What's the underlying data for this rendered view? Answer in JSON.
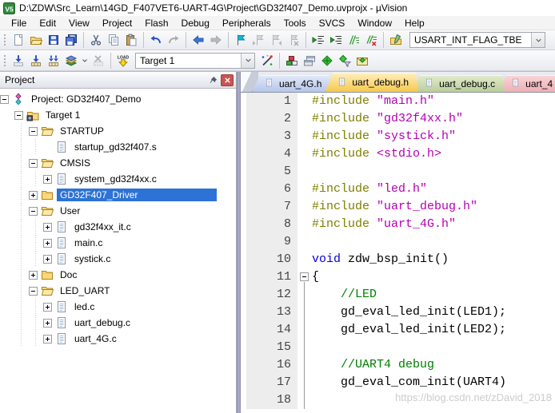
{
  "window": {
    "title": "D:\\ZDW\\Src_Learn\\14GD_F407VET6-UART-4G\\Project\\GD32f407_Demo.uvprojx - µVision"
  },
  "menu": {
    "items": [
      "File",
      "Edit",
      "View",
      "Project",
      "Flash",
      "Debug",
      "Peripherals",
      "Tools",
      "SVCS",
      "Window",
      "Help"
    ]
  },
  "toolbar1": {
    "groups": [
      [
        {
          "n": "new-file"
        },
        {
          "n": "open-file"
        },
        {
          "n": "save"
        },
        {
          "n": "save-all"
        }
      ],
      [
        {
          "n": "cut"
        },
        {
          "n": "copy"
        },
        {
          "n": "paste"
        }
      ],
      [
        {
          "n": "undo"
        },
        {
          "n": "redo",
          "d": true
        }
      ],
      [
        {
          "n": "navigate-back"
        },
        {
          "n": "navigate-forward",
          "d": true
        }
      ],
      [
        {
          "n": "toggle-bookmark"
        },
        {
          "n": "prev-bookmark",
          "d": true
        },
        {
          "n": "next-bookmark",
          "d": true
        },
        {
          "n": "clear-bookmarks",
          "d": true
        }
      ],
      [
        {
          "n": "outdent"
        },
        {
          "n": "indent"
        },
        {
          "n": "comment-selection"
        },
        {
          "n": "uncomment-selection"
        }
      ],
      [
        {
          "n": "find-in-files"
        }
      ]
    ],
    "search_value": "USART_INT_FLAG_TBE"
  },
  "toolbar2": {
    "left_groups": [
      [
        {
          "n": "translate-file"
        },
        {
          "n": "build"
        },
        {
          "n": "rebuild-all"
        },
        {
          "n": "batch-build"
        },
        {
          "n": "batch-build-caret",
          "caret": true
        },
        {
          "n": "stop-build",
          "d": true
        }
      ],
      [
        {
          "n": "download-load"
        }
      ]
    ],
    "target_value": "Target 1",
    "right_groups": [
      [
        {
          "n": "options-for-target"
        }
      ],
      [
        {
          "n": "manage-components"
        },
        {
          "n": "manage-books"
        },
        {
          "n": "manage-run-time-environment"
        },
        {
          "n": "select-software-packs"
        },
        {
          "n": "pack-installer"
        }
      ]
    ]
  },
  "project_panel": {
    "title": "Project",
    "tree": [
      {
        "label": "Project: GD32f407_Demo",
        "level": 0,
        "exp": "minus",
        "icon": "project"
      },
      {
        "label": "Target 1",
        "level": 1,
        "exp": "minus",
        "icon": "target"
      },
      {
        "label": "STARTUP",
        "level": 2,
        "exp": "minus",
        "icon": "folder-open"
      },
      {
        "label": "startup_gd32f407.s",
        "level": 3,
        "exp": "none",
        "icon": "file"
      },
      {
        "label": "CMSIS",
        "level": 2,
        "exp": "minus",
        "icon": "folder-open"
      },
      {
        "label": "system_gd32f4xx.c",
        "level": 3,
        "exp": "plus",
        "icon": "file"
      },
      {
        "label": "GD32F407_Driver",
        "level": 2,
        "exp": "plus",
        "icon": "folder-closed",
        "selected": true
      },
      {
        "label": "User",
        "level": 2,
        "exp": "minus",
        "icon": "folder-open"
      },
      {
        "label": "gd32f4xx_it.c",
        "level": 3,
        "exp": "plus",
        "icon": "file"
      },
      {
        "label": "main.c",
        "level": 3,
        "exp": "plus",
        "icon": "file"
      },
      {
        "label": "systick.c",
        "level": 3,
        "exp": "plus",
        "icon": "file"
      },
      {
        "label": "Doc",
        "level": 2,
        "exp": "plus",
        "icon": "folder-closed"
      },
      {
        "label": "LED_UART",
        "level": 2,
        "exp": "minus",
        "icon": "folder-open"
      },
      {
        "label": "led.c",
        "level": 3,
        "exp": "plus",
        "icon": "file"
      },
      {
        "label": "uart_debug.c",
        "level": 3,
        "exp": "plus",
        "icon": "file"
      },
      {
        "label": "uart_4G.c",
        "level": 3,
        "exp": "plus",
        "icon": "file"
      }
    ]
  },
  "editor": {
    "tabs": [
      {
        "label": "uart_4G.h",
        "color": "blue",
        "active": false
      },
      {
        "label": "uart_debug.h",
        "color": "yellow",
        "active": true
      },
      {
        "label": "uart_debug.c",
        "color": "green",
        "active": false
      },
      {
        "label": "uart_4",
        "color": "pink",
        "active": false,
        "cut": true
      }
    ],
    "code_lines": [
      {
        "num": 1,
        "fold": "",
        "segs": [
          [
            "#include ",
            "dir"
          ],
          [
            "\"main.h\"",
            "str"
          ]
        ]
      },
      {
        "num": 2,
        "fold": "",
        "segs": [
          [
            "#include ",
            "dir"
          ],
          [
            "\"gd32f4xx.h\"",
            "str"
          ]
        ]
      },
      {
        "num": 3,
        "fold": "",
        "segs": [
          [
            "#include ",
            "dir"
          ],
          [
            "\"systick.h\"",
            "str"
          ]
        ]
      },
      {
        "num": 4,
        "fold": "",
        "segs": [
          [
            "#include ",
            "dir"
          ],
          [
            "<stdio.h>",
            "str"
          ]
        ]
      },
      {
        "num": 5,
        "fold": "",
        "segs": []
      },
      {
        "num": 6,
        "fold": "",
        "segs": [
          [
            "#include ",
            "dir"
          ],
          [
            "\"led.h\"",
            "str"
          ]
        ]
      },
      {
        "num": 7,
        "fold": "",
        "segs": [
          [
            "#include ",
            "dir"
          ],
          [
            "\"uart_debug.h\"",
            "str"
          ]
        ]
      },
      {
        "num": 8,
        "fold": "",
        "segs": [
          [
            "#include ",
            "dir"
          ],
          [
            "\"uart_4G.h\"",
            "str"
          ]
        ]
      },
      {
        "num": 9,
        "fold": "",
        "segs": []
      },
      {
        "num": 10,
        "fold": "",
        "segs": [
          [
            "void",
            "kw"
          ],
          [
            " zdw_bsp_init()",
            "pl"
          ]
        ]
      },
      {
        "num": 11,
        "fold": "box",
        "segs": [
          [
            "{",
            "pl"
          ]
        ]
      },
      {
        "num": 12,
        "fold": "line",
        "segs": [
          [
            "    ",
            "pl"
          ],
          [
            "//LED",
            "com"
          ]
        ]
      },
      {
        "num": 13,
        "fold": "line",
        "segs": [
          [
            "    gd_eval_led_init(LED1);",
            "pl"
          ]
        ]
      },
      {
        "num": 14,
        "fold": "line",
        "segs": [
          [
            "    gd_eval_led_init(LED2);",
            "pl"
          ]
        ]
      },
      {
        "num": 15,
        "fold": "line",
        "segs": []
      },
      {
        "num": 16,
        "fold": "line",
        "segs": [
          [
            "    ",
            "pl"
          ],
          [
            "//UART4 debug",
            "com"
          ]
        ]
      },
      {
        "num": 17,
        "fold": "line",
        "segs": [
          [
            "    gd_eval_com_init(UART4)",
            "pl"
          ]
        ]
      },
      {
        "num": 18,
        "fold": "line",
        "segs": []
      }
    ],
    "watermark": "https://blog.csdn.net/zDavid_2018"
  },
  "colors": {
    "selection_blue": "#2d72d6",
    "tab_blue": "#b7c6ea",
    "tab_yellow": "#f6c84d",
    "tab_green": "#bccd9c",
    "tab_pink": "#eeafb6",
    "syntax_directive": "#7f7f00",
    "syntax_string": "#b400b4",
    "syntax_keyword": "#0000e0",
    "syntax_comment": "#008000",
    "gutter_bg": "#ededed"
  }
}
